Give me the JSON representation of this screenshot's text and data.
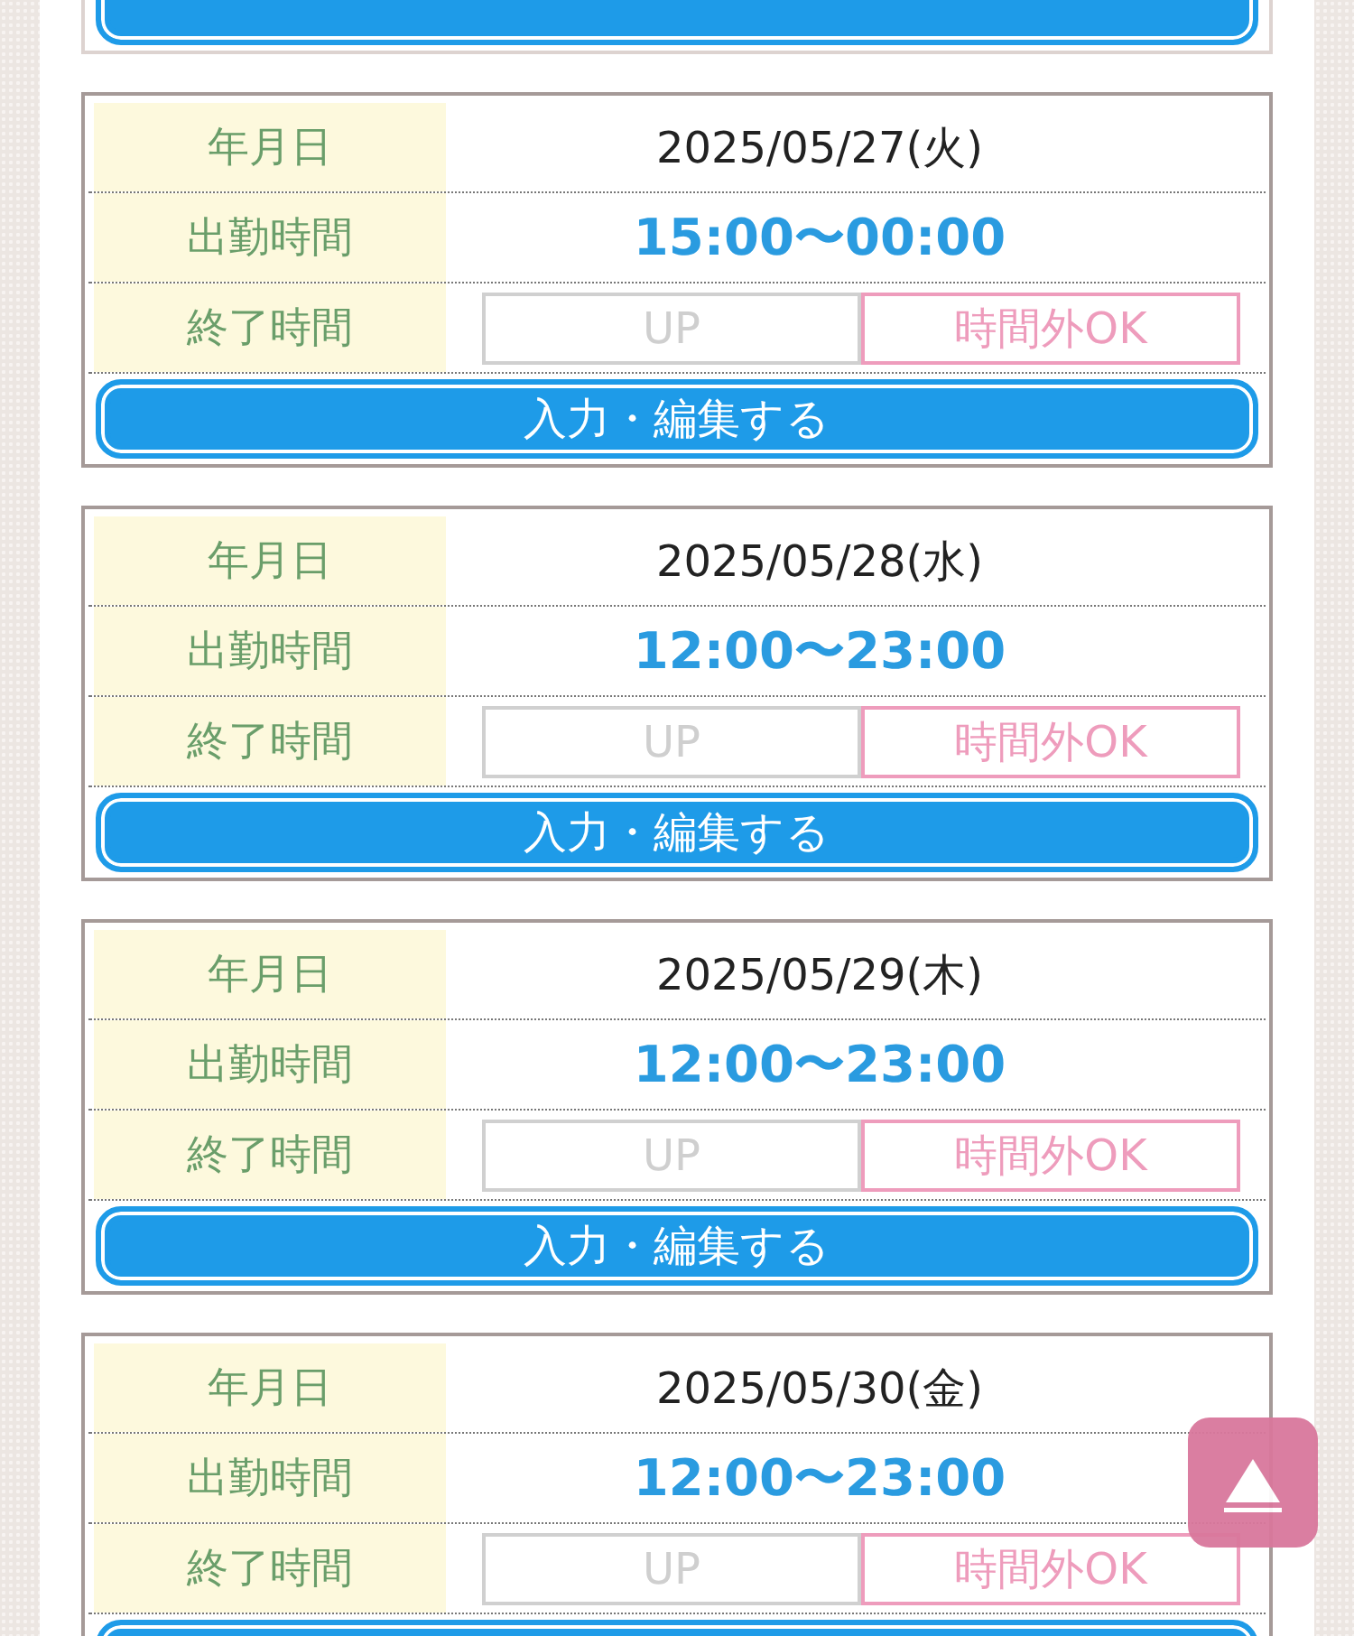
{
  "shifts": [
    {
      "date_label": "年月日",
      "date": "2025/05/27(火)",
      "start_label": "出勤時間",
      "time": "15:00〜00:00",
      "end_label": "終了時間",
      "up": "UP",
      "overtime": "時間外OK",
      "button": "入力・編集する"
    },
    {
      "date_label": "年月日",
      "date": "2025/05/28(水)",
      "start_label": "出勤時間",
      "time": "12:00〜23:00",
      "end_label": "終了時間",
      "up": "UP",
      "overtime": "時間外OK",
      "button": "入力・編集する"
    },
    {
      "date_label": "年月日",
      "date": "2025/05/29(木)",
      "start_label": "出勤時間",
      "time": "12:00〜23:00",
      "end_label": "終了時間",
      "up": "UP",
      "overtime": "時間外OK",
      "button": "入力・編集する"
    },
    {
      "date_label": "年月日",
      "date": "2025/05/30(金)",
      "start_label": "出勤時間",
      "time": "12:00〜23:00",
      "end_label": "終了時間",
      "up": "UP",
      "overtime": "時間外OK"
    }
  ]
}
